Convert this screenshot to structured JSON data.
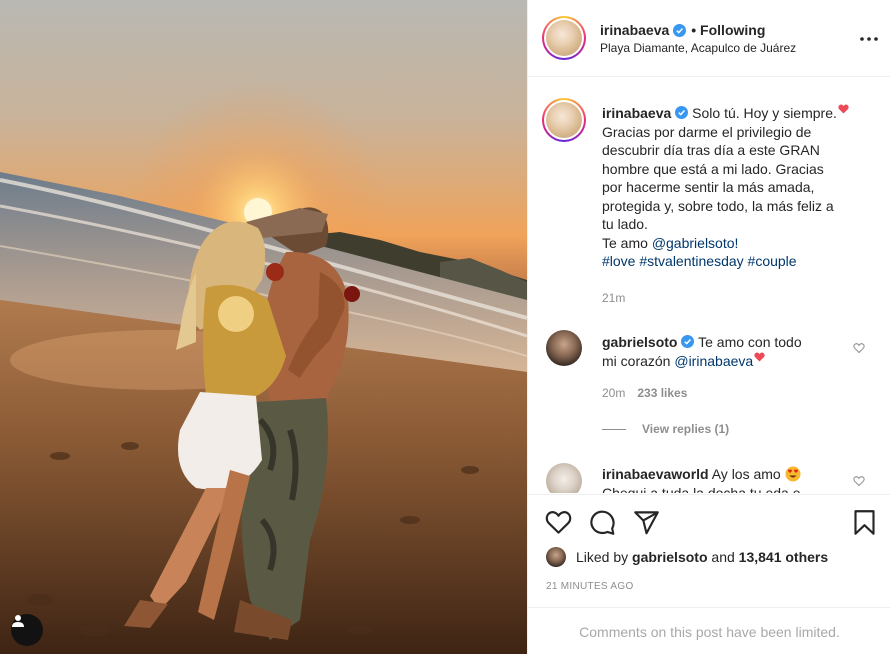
{
  "post": {
    "author": "irinabaeva",
    "follow_state": "• Following",
    "location": "Playa Diamante, Acapulco de Juárez"
  },
  "caption": {
    "author": "irinabaeva",
    "text_lines": [
      "Solo tú. Hoy y siempre.",
      "Gracias por darme el privilegio de",
      "descubrir día tras día a este GRAN",
      "hombre que está a mi lado. Gracias",
      "por hacerme sentir la más amada,",
      "protegida y, sobre todo, la más feliz a",
      "tu lado."
    ],
    "love_prefix": "Te amo ",
    "mention": "@gabrielsoto!",
    "hashtags": "#love #stvalentinesday #couple",
    "time": "21m"
  },
  "comments": [
    {
      "author": "gabrielsoto",
      "text_line1": "Te amo con todo",
      "text_line2_prefix": "mi corazón ",
      "mention": "@irinabaeva",
      "time": "20m",
      "likes": "233 likes",
      "view_replies": "View replies (1)"
    },
    {
      "author": "irinabaevaworld",
      "text": "Ay los amo",
      "cut_line": "Chequi a tuda la docha tu eda e"
    }
  ],
  "likes": {
    "prefix": "Liked by ",
    "user": "gabrielsoto",
    "middle": " and ",
    "count": "13,841 others"
  },
  "timestamp": "21 MINUTES AGO",
  "limited_notice": "Comments on this post have been limited.",
  "icons": {
    "more": "more-horizontal-icon",
    "like": "heart-icon",
    "comment": "comment-icon",
    "share": "paper-plane-icon",
    "save": "bookmark-icon",
    "verified": "verified-badge-icon",
    "user_tag": "user-tag-icon"
  },
  "colors": {
    "text": "#262626",
    "secondary": "#8e8e8e",
    "link": "#00376b",
    "verified": "#3897f0",
    "border": "#efefef",
    "heart_emoji": "#ed4956"
  }
}
